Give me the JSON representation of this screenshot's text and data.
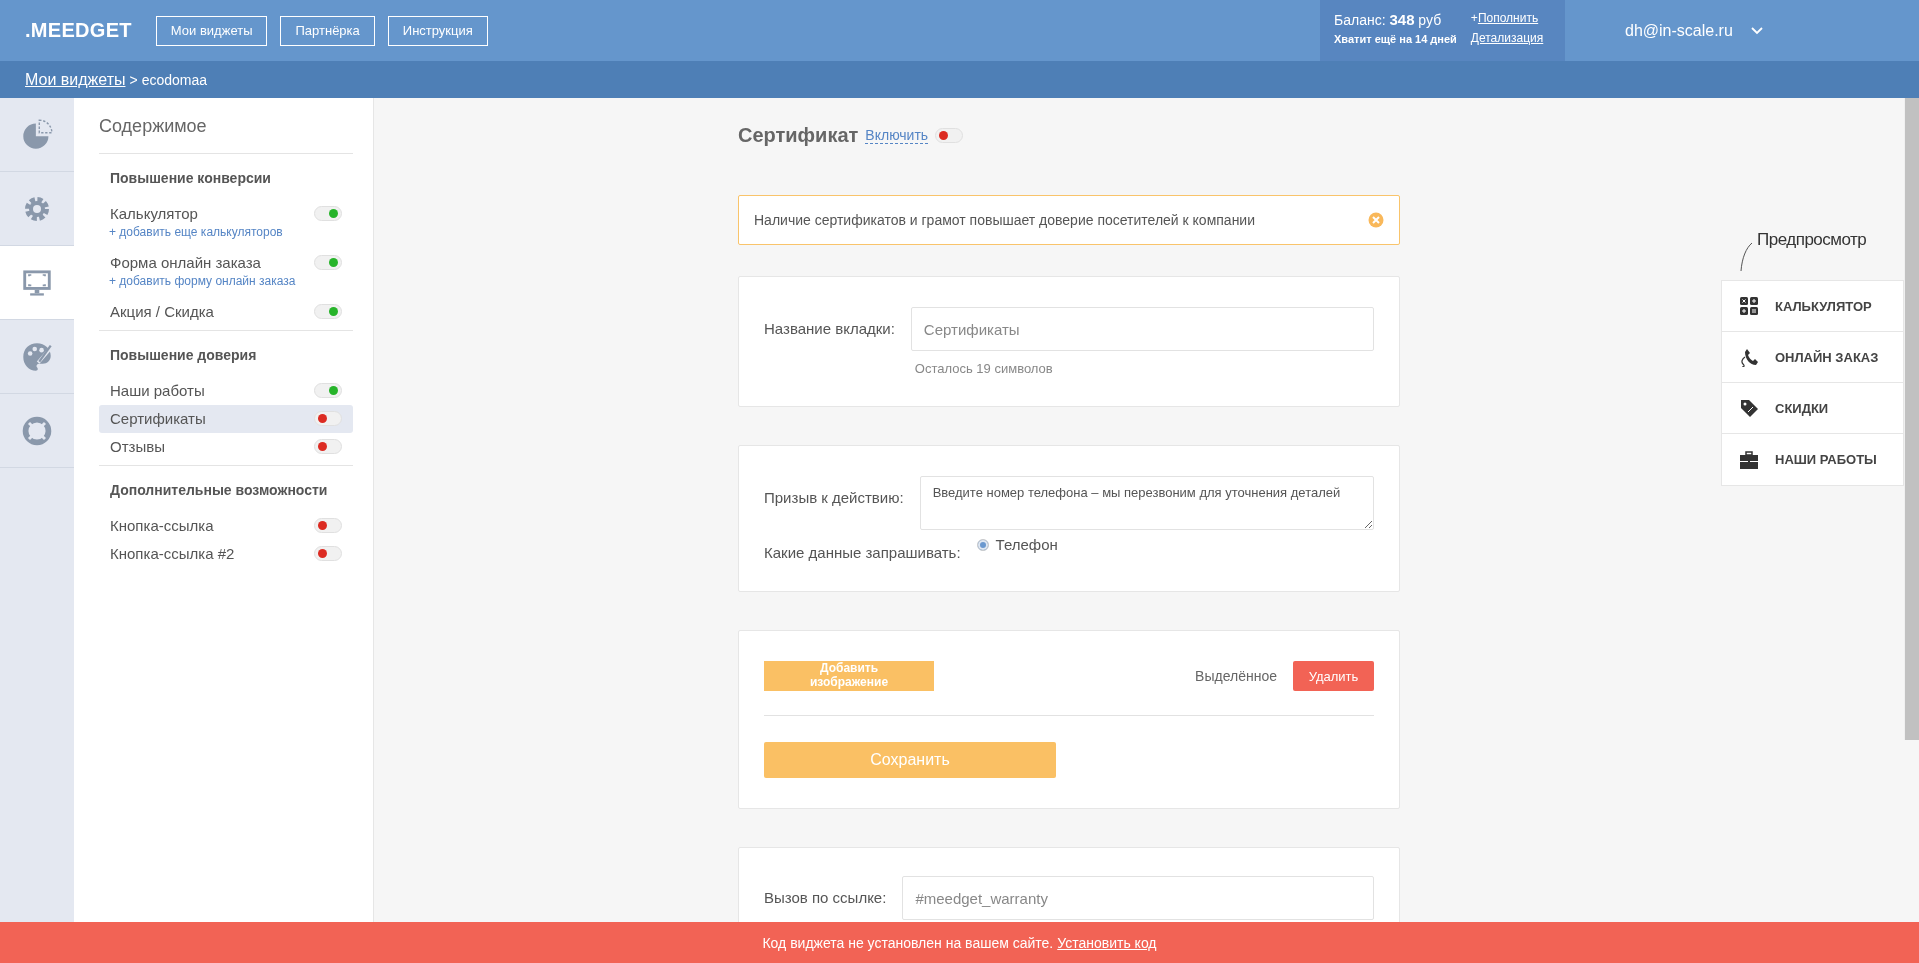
{
  "header": {
    "logo": ".MEEDGET",
    "nav": [
      "Мои виджеты",
      "Партнёрка",
      "Инструкция"
    ],
    "balance": {
      "label": "Баланс:",
      "amount": "348",
      "currency": "руб",
      "note": "Хватит ещё на 14 дней",
      "topup_prefix": "+",
      "topup": "Пополнить",
      "details": "Детализация"
    },
    "user": "dh@in-scale.ru"
  },
  "breadcrumb": {
    "parent": "Мои виджеты",
    "separator": ">",
    "current": "ecodomaa"
  },
  "icon_rail": [
    {
      "kind": "chart",
      "selected": false
    },
    {
      "kind": "gear",
      "selected": false
    },
    {
      "kind": "monitor",
      "selected": true
    },
    {
      "kind": "palette",
      "selected": false
    },
    {
      "kind": "lifebuoy",
      "selected": false
    }
  ],
  "sidebar": {
    "title": "Содержимое",
    "sections": [
      {
        "title": "Повышение конверсии",
        "items": [
          {
            "label": "Калькулятор",
            "on": true,
            "selected": false,
            "add_link": "+ добавить еще калькуляторов"
          },
          {
            "label": "Форма онлайн заказа",
            "on": true,
            "selected": false,
            "add_link": "+ добавить форму онлайн заказа"
          },
          {
            "label": "Акция / Скидка",
            "on": true,
            "selected": false
          }
        ]
      },
      {
        "title": "Повышение доверия",
        "items": [
          {
            "label": "Наши работы",
            "on": true,
            "selected": false
          },
          {
            "label": "Сертификаты",
            "on": false,
            "selected": true
          },
          {
            "label": "Отзывы",
            "on": false,
            "selected": false
          }
        ]
      },
      {
        "title": "Дополнительные возможности",
        "items": [
          {
            "label": "Кнопка-ссылка",
            "on": false,
            "selected": false
          },
          {
            "label": "Кнопка-ссылка #2",
            "on": false,
            "selected": false
          }
        ]
      }
    ]
  },
  "main": {
    "title": "Сертификат",
    "enable_link": "Включить",
    "enabled": false,
    "alert": "Наличие сертификатов и грамот повышает доверие посетителей к компании",
    "tab_name": {
      "label": "Название вкладки:",
      "placeholder": "Сертификаты",
      "hint": "Осталось 19 символов"
    },
    "cta": {
      "label": "Призыв к действию:",
      "value": "Введите номер телефона – мы перезвоним для уточнения деталей",
      "data_label": "Какие данные запрашивать:",
      "options": [
        {
          "label": "Телефон",
          "selected": true
        }
      ]
    },
    "images": {
      "add_button": "Добавить изображение",
      "selected_label": "Выделённое",
      "delete_button": "Удалить",
      "save_button": "Сохранить"
    },
    "link_call": {
      "label": "Вызов по ссылке:",
      "placeholder": "#meedget_warranty"
    }
  },
  "preview": {
    "label": "Предпросмотр",
    "items": [
      {
        "kind": "calculator",
        "label": "КАЛЬКУЛЯТОР"
      },
      {
        "kind": "phone",
        "label": "ОНЛАЙН ЗАКАЗ"
      },
      {
        "kind": "tag",
        "label": "СКИДКИ"
      },
      {
        "kind": "briefcase",
        "label": "НАШИ РАБОТЫ"
      }
    ]
  },
  "bottom_bar": {
    "text": "Код виджета не установлен на вашем сайте.",
    "link": "Установить код"
  }
}
